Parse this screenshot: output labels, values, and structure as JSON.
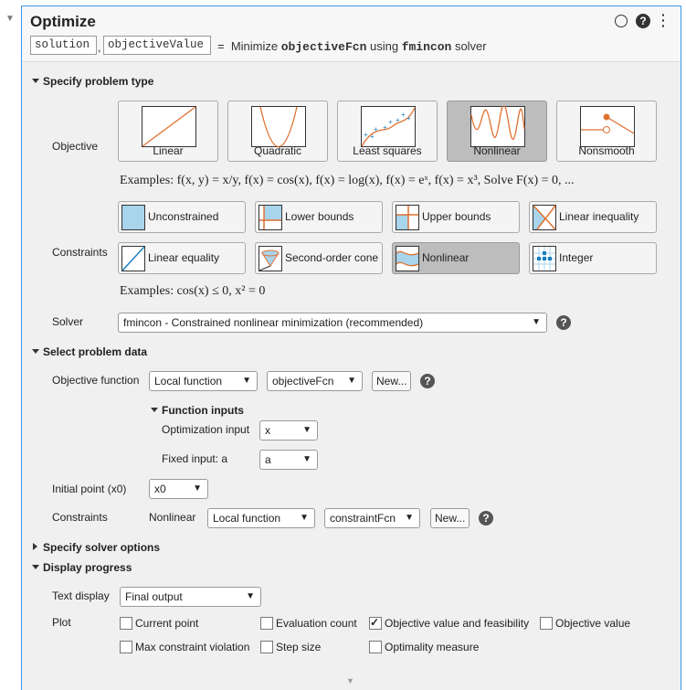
{
  "header": {
    "title": "Optimize",
    "outputs": [
      "solution",
      "objectiveValue"
    ],
    "eq": "=",
    "summary_pre": "Minimize",
    "fcn": "objectiveFcn",
    "summary_mid": "using",
    "solver": "fmincon",
    "summary_post": "solver"
  },
  "sections": {
    "problem_type": "Specify problem type",
    "problem_data": "Select problem data",
    "solver_options": "Specify solver options",
    "display": "Display progress"
  },
  "objective": {
    "label": "Objective",
    "options": [
      "Linear",
      "Quadratic",
      "Least squares",
      "Nonlinear",
      "Nonsmooth"
    ],
    "selected": "Nonlinear",
    "examples": "Examples: f(x, y) = x/y, f(x) = cos(x), f(x) = log(x), f(x) = eˣ, f(x) = x³, Solve F(x) = 0, ..."
  },
  "constraints": {
    "label": "Constraints",
    "options": [
      "Unconstrained",
      "Lower bounds",
      "Upper bounds",
      "Linear inequality",
      "Linear equality",
      "Second-order cone",
      "Nonlinear",
      "Integer"
    ],
    "selected": "Nonlinear",
    "examples": "Examples: cos(x) ≤ 0, x² = 0"
  },
  "solver": {
    "label": "Solver",
    "value": "fmincon - Constrained nonlinear minimization (recommended)"
  },
  "data": {
    "objective_label": "Objective function",
    "objective_source": "Local function",
    "objective_fcn": "objectiveFcn",
    "new_label": "New...",
    "function_inputs": "Function inputs",
    "opt_input_label": "Optimization input",
    "opt_input": "x",
    "fixed_label": "Fixed input: a",
    "fixed_input": "a",
    "x0_label": "Initial point (x0)",
    "x0": "x0",
    "con_label": "Constraints",
    "con_type": "Nonlinear",
    "con_source": "Local function",
    "con_fcn": "constraintFcn"
  },
  "display": {
    "text_label": "Text display",
    "text_value": "Final output",
    "plot_label": "Plot",
    "plots": [
      {
        "label": "Current point",
        "checked": false
      },
      {
        "label": "Evaluation count",
        "checked": false
      },
      {
        "label": "Objective value and feasibility",
        "checked": true
      },
      {
        "label": "Objective value",
        "checked": false
      },
      {
        "label": "Max constraint violation",
        "checked": false
      },
      {
        "label": "Step size",
        "checked": false
      },
      {
        "label": "Optimality measure",
        "checked": false
      }
    ]
  },
  "colors": {
    "accent": "#3d9ae8",
    "curve": "#e07030",
    "points": "#1a7fc0"
  }
}
